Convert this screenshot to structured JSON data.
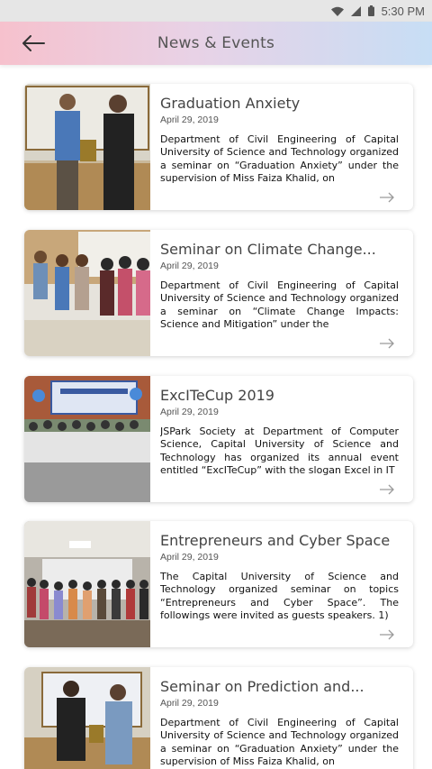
{
  "status_bar": {
    "time": "5:30 PM",
    "icons": [
      "wifi-icon",
      "signal-icon",
      "battery-icon"
    ]
  },
  "header": {
    "title": "News & Events",
    "back_icon": "arrow-left-icon"
  },
  "events": [
    {
      "title": "Graduation Anxiety",
      "date": "April 29, 2019",
      "excerpt": "Department of Civil Engineering of Capital University of Science and Technology organized a seminar on “Graduation Anxiety” under the supervision of Miss Faiza Khalid, on"
    },
    {
      "title": "Seminar on Climate Change...",
      "date": "April 29, 2019",
      "excerpt": "Department of Civil Engineering of Capital University of Science and Technology organized a seminar on “Climate Change Impacts: Science and Mitigation” under the"
    },
    {
      "title": "ExcITeCup 2019",
      "date": "April 29, 2019",
      "excerpt": "JSPark Society at Department of Computer Science, Capital University of Science and Technology has organized its annual event entitled “ExcITeCup” with the slogan Excel in IT"
    },
    {
      "title": "Entrepreneurs and Cyber Space",
      "date": "April 29, 2019",
      "excerpt": "The Capital University of Science and Technology organized seminar on topics “Entrepreneurs and Cyber Space”. The followings were invited as guests speakers. 1)"
    },
    {
      "title": "Seminar on Prediction and...",
      "date": "April 29, 2019",
      "excerpt": "Department of Civil Engineering of Capital University of Science and Technology organized a seminar on “Graduation Anxiety” under the supervision of Miss Faiza Khalid, on"
    }
  ],
  "colors": {
    "header_left": "#f6c1cd",
    "header_right": "#c7def5",
    "arrow": "#9a9a9a"
  }
}
